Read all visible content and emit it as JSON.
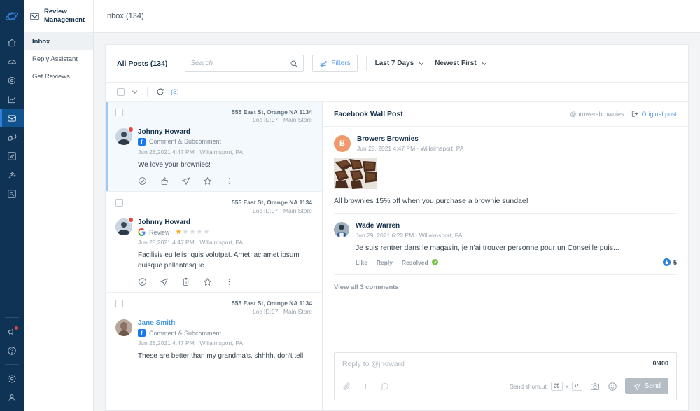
{
  "rail": {
    "logo_icon": "planet-logo-icon",
    "items": [
      {
        "icon": "home-icon",
        "name": "home",
        "active": false
      },
      {
        "icon": "dashboard-gauge-icon",
        "name": "dashboard",
        "active": false
      },
      {
        "icon": "location-pin-icon",
        "name": "locations",
        "active": false
      },
      {
        "icon": "analytics-chart-icon",
        "name": "analytics",
        "active": false
      },
      {
        "icon": "inbox-envelope-icon",
        "name": "inbox",
        "active": true
      },
      {
        "icon": "chat-bubbles-icon",
        "name": "messaging",
        "active": false
      },
      {
        "icon": "compose-pencil-icon",
        "name": "compose",
        "active": false
      },
      {
        "icon": "sparkle-wand-icon",
        "name": "insights",
        "active": false
      },
      {
        "icon": "image-search-icon",
        "name": "media",
        "active": false
      }
    ],
    "bottom_items": [
      {
        "icon": "megaphone-icon",
        "name": "announcements",
        "badge": true
      },
      {
        "icon": "help-circle-icon",
        "name": "help",
        "badge": false
      },
      {
        "icon": "gear-icon",
        "name": "settings",
        "badge": false
      },
      {
        "icon": "user-icon",
        "name": "account",
        "badge": false
      }
    ]
  },
  "nav": {
    "icon": "envelope-icon",
    "title": "Review Management",
    "items": [
      {
        "label": "Inbox",
        "active": true
      },
      {
        "label": "Reply Assistant",
        "active": false
      },
      {
        "label": "Get Reviews",
        "active": false
      }
    ]
  },
  "topbar": {
    "title": "Inbox (134)"
  },
  "toolbar": {
    "all_posts_label": "All Posts (134)",
    "search_placeholder": "Search",
    "search_value": "",
    "search_icon": "search-icon",
    "filters_label": "Filters",
    "filters_icon": "sliders-icon",
    "date_range": "Last 7 Days",
    "sort_order": "Newest First",
    "chevron_icon": "chevron-down-icon"
  },
  "bulkbar": {
    "select_all_checked": false,
    "chevron_icon": "chevron-down-icon",
    "refresh_icon": "refresh-icon",
    "refresh_count": "(3)"
  },
  "list": {
    "cards": [
      {
        "selected": true,
        "location_address": "555 East St, Orange NA 1134",
        "location_sub": "Loc ID:97  ·  Main Store",
        "author": "Johnny Howard",
        "author_is_link": false,
        "unread": true,
        "source_icon": "facebook-icon",
        "source_label": "Comment & Subcomment",
        "rating": null,
        "timestamp": "Jun 28,2021 4:47 PM  ·  Willaimsport, PA",
        "text": "We love your brownies!",
        "actions": [
          {
            "icon": "check-circle-icon",
            "name": "resolve-action"
          },
          {
            "icon": "thumbs-up-icon",
            "name": "like-action"
          },
          {
            "icon": "send-plane-icon",
            "name": "reply-action"
          },
          {
            "icon": "star-icon",
            "name": "favorite-action"
          },
          {
            "icon": "more-vertical-icon",
            "name": "more-action"
          }
        ]
      },
      {
        "selected": false,
        "location_address": "555 East St, Orange NA 1134",
        "location_sub": "Loc ID:97  ·  Main Store",
        "author": "Johnny Howard",
        "author_is_link": false,
        "unread": true,
        "source_icon": "google-icon",
        "source_label": "Review",
        "rating": 1,
        "rating_max": 5,
        "timestamp": "Jun 28,2021 4:47 PM  ·  Willaimsport, PA",
        "text": "Facilisis eu felis, quis volutpat. Amet, ac amet ipsum quisque pellentesque.",
        "actions": [
          {
            "icon": "check-circle-icon",
            "name": "resolve-action"
          },
          {
            "icon": "send-plane-icon",
            "name": "reply-action"
          },
          {
            "icon": "clipboard-icon",
            "name": "copy-action"
          },
          {
            "icon": "star-icon",
            "name": "favorite-action"
          },
          {
            "icon": "more-vertical-icon",
            "name": "more-action"
          }
        ]
      },
      {
        "selected": false,
        "location_address": "555 East St, Orange NA 1134",
        "location_sub": "Loc ID:97  ·  Main Store",
        "author": "Jane Smith",
        "author_is_link": true,
        "unread": false,
        "source_icon": "facebook-icon",
        "source_label": "Comment & Subcomment",
        "rating": null,
        "timestamp": "Jun 28,2021 4:47 PM  ·  Willaimsport, PA",
        "text": "These are better than my grandma's, shhhh, don't tell",
        "actions": []
      }
    ]
  },
  "detail": {
    "title": "Facebook Wall Post",
    "handle": "@browersbrownies",
    "original_post_label": "Original post",
    "original_post_icon": "external-link-icon",
    "post": {
      "avatar_initial": "B",
      "name": "Browers Brownies",
      "timestamp": "Jun 28, 2021 4:47 PM  ·  Willaimsport, PA",
      "image_alt": "brownies-photo",
      "text": "All brownies 15% off when you purchase a brownie sundae!"
    },
    "comments": [
      {
        "name": "Wade Warren",
        "timestamp": "Jun 29, 2021 6:22 PM  ·  Willaimsport, PA",
        "text": "Je suis rentrer dans le magasin, je n'ai trouver personne pour un Conseille puis...",
        "actions": [
          "Like",
          "Reply",
          "Resolved"
        ],
        "resolved_icon": "check-badge-icon",
        "like_icon": "facebook-like-icon",
        "like_count": "5"
      }
    ],
    "view_all_label": "View all 3 comments"
  },
  "composer": {
    "placeholder": "Reply to @jhoward",
    "value": "",
    "counter": "0/400",
    "left_icons": [
      {
        "icon": "attachment-icon",
        "name": "attach-button"
      },
      {
        "icon": "plus-icon",
        "name": "add-button"
      },
      {
        "icon": "comment-dots-icon",
        "name": "canned-response-button"
      }
    ],
    "shortcut_label": "Send shortcut:",
    "shortcut_keys": [
      "⌘",
      "+",
      "↵"
    ],
    "right_icons": [
      {
        "icon": "camera-icon",
        "name": "photo-button"
      },
      {
        "icon": "smiley-icon",
        "name": "emoji-button"
      }
    ],
    "send_label": "Send",
    "send_icon": "send-plane-icon"
  },
  "colors": {
    "rail_bg": "#0f3354",
    "rail_active": "#10538f",
    "accent_blue": "#5c9ee8",
    "link_blue": "#4a9ae0",
    "star_orange": "#f5a623",
    "resolved_green": "#7ac143",
    "unread_red": "#e8453c",
    "facebook_blue": "#1877f2",
    "send_disabled": "#b5bdc4"
  }
}
